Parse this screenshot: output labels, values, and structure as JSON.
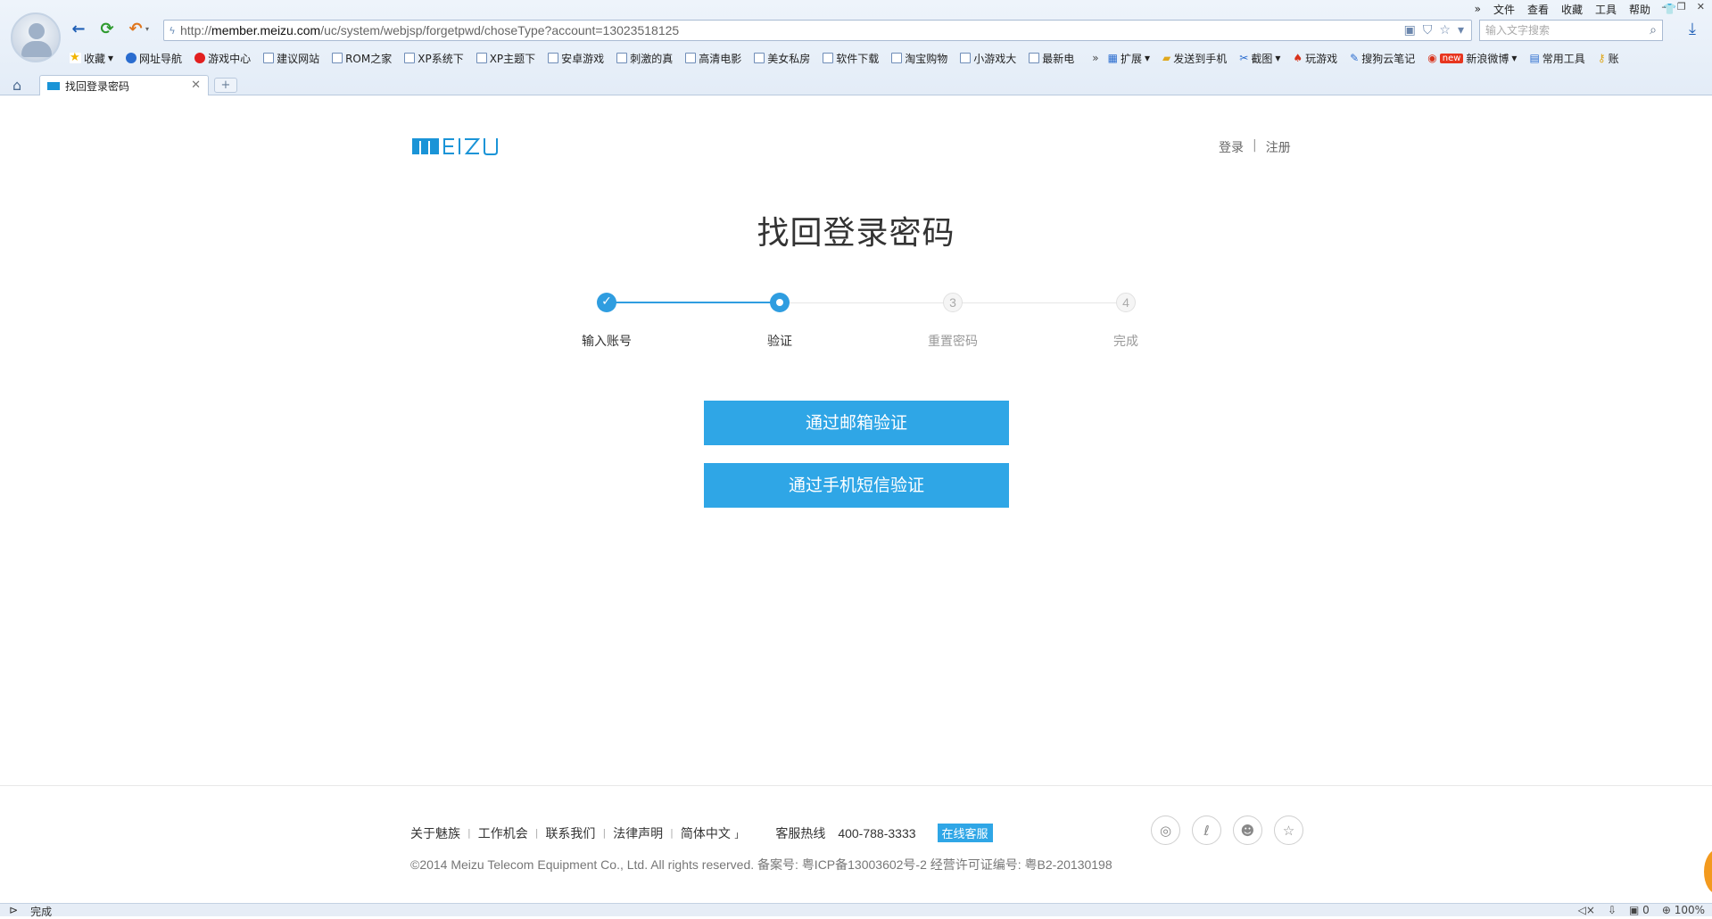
{
  "browser": {
    "menu": [
      "文件",
      "查看",
      "收藏",
      "工具",
      "帮助"
    ],
    "menu_more": "»",
    "url_prefix": "http://",
    "url_domain": "member.meizu.com",
    "url_path": "/uc/system/webjsp/forgetpwd/choseType?account=13023518125",
    "search_placeholder": "输入文字搜索",
    "bookmarks": [
      {
        "label": "收藏",
        "icon": "star-icon"
      },
      {
        "label": "网址导航",
        "icon": "sogou-icon"
      },
      {
        "label": "游戏中心",
        "icon": "game-icon"
      },
      {
        "label": "建议网站",
        "icon": "page-icon"
      },
      {
        "label": "ROM之家",
        "icon": "page-icon"
      },
      {
        "label": "XP系统下",
        "icon": "page-icon"
      },
      {
        "label": "XP主题下",
        "icon": "page-icon"
      },
      {
        "label": "安卓游戏",
        "icon": "page-icon"
      },
      {
        "label": "刺激的真",
        "icon": "page-icon"
      },
      {
        "label": "高清电影",
        "icon": "page-icon"
      },
      {
        "label": "美女私房",
        "icon": "page-icon"
      },
      {
        "label": "软件下载",
        "icon": "page-icon"
      },
      {
        "label": "淘宝购物",
        "icon": "page-icon"
      },
      {
        "label": "小游戏大",
        "icon": "page-icon"
      },
      {
        "label": "最新电",
        "icon": "page-icon"
      }
    ],
    "bookmarks_more": "»",
    "tools": [
      {
        "label": "扩展",
        "icon": "extension-icon"
      },
      {
        "label": "发送到手机",
        "icon": "phone-icon"
      },
      {
        "label": "截图",
        "icon": "screenshot-icon"
      },
      {
        "label": "玩游戏",
        "icon": "gamepad-icon"
      },
      {
        "label": "搜狗云笔记",
        "icon": "note-icon"
      },
      {
        "label": "新浪微博",
        "icon": "weibo-icon",
        "badge": "new"
      },
      {
        "label": "常用工具",
        "icon": "tools-icon"
      },
      {
        "label": "账",
        "icon": "key-icon"
      }
    ],
    "tab_title": "找回登录密码",
    "new_tab": "+",
    "status_text": "完成",
    "status_right": {
      "count": "0",
      "zoom": "100%"
    }
  },
  "page": {
    "logo_text": "MEIZU",
    "login_link": "登录",
    "separator": "|",
    "register_link": "注册",
    "title": "找回登录密码",
    "steps": [
      {
        "label": "输入账号",
        "state": "done",
        "num": ""
      },
      {
        "label": "验证",
        "state": "active",
        "num": ""
      },
      {
        "label": "重置密码",
        "state": "pending",
        "num": "3"
      },
      {
        "label": "完成",
        "state": "pending",
        "num": "4"
      }
    ],
    "email_verify": "通过邮箱验证",
    "sms_verify": "通过手机短信验证",
    "footer": {
      "links": [
        "关于魅族",
        "工作机会",
        "联系我们",
        "法律声明",
        "简体中文"
      ],
      "lang_caret": "」",
      "hotline_label": "客服热线",
      "hotline_number": "400-788-3333",
      "online_service": "在线客服",
      "copyright": "©2014 Meizu Telecom Equipment Co., Ltd. All rights reserved. 备案号: 粤ICP备13003602号-2 经营许可证编号: 粤B2-20130198"
    }
  },
  "colors": {
    "accent": "#2fa6e6",
    "step_active": "#2f9de0",
    "logo": "#1a94d7"
  }
}
